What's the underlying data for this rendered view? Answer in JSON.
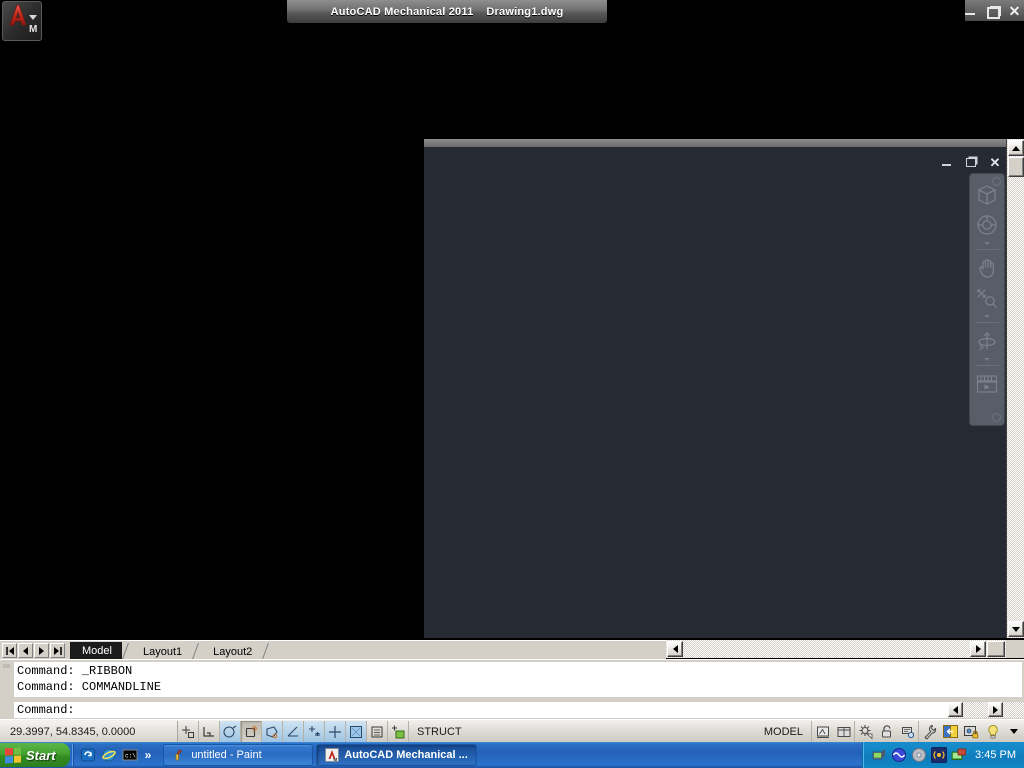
{
  "window": {
    "title": "AutoCAD Mechanical 2011    Drawing1.dwg",
    "app_button_label": "M",
    "controls": {
      "minimize": "Minimize",
      "restore": "Restore",
      "close": "Close"
    }
  },
  "drawing_window": {
    "controls": {
      "minimize": "Minimize",
      "restore": "Restore",
      "close": "Close"
    },
    "navbar": {
      "items": [
        {
          "name": "viewcube",
          "label": "ViewCube"
        },
        {
          "name": "steering-wheel",
          "label": "SteeringWheels"
        },
        {
          "name": "pan",
          "label": "Pan"
        },
        {
          "name": "zoom",
          "label": "Zoom Extents"
        },
        {
          "name": "orbit",
          "label": "Orbit"
        },
        {
          "name": "showmotion",
          "label": "ShowMotion"
        }
      ]
    }
  },
  "layout_tabs": {
    "nav_buttons": [
      "first",
      "previous",
      "next",
      "last"
    ],
    "tabs": [
      {
        "label": "Model",
        "active": true
      },
      {
        "label": "Layout1",
        "active": false
      },
      {
        "label": "Layout2",
        "active": false
      }
    ]
  },
  "command_window": {
    "history": "Command: _RIBBON\nCommand: COMMANDLINE",
    "prompt": "Command:",
    "input_value": ""
  },
  "status_bar": {
    "coordinates": "29.3997, 54.8345, 0.0000",
    "toggles": [
      {
        "name": "infer-constraints",
        "label": "Infer Constraints",
        "state": "off"
      },
      {
        "name": "snap-mode",
        "label": "Snap Mode",
        "state": "off"
      },
      {
        "name": "grid-display",
        "label": "Grid Display",
        "state": "on"
      },
      {
        "name": "ortho-mode",
        "label": "Ortho Mode",
        "state": "pressed"
      },
      {
        "name": "polar-tracking",
        "label": "Polar Tracking",
        "state": "on"
      },
      {
        "name": "object-snap",
        "label": "Object Snap",
        "state": "on"
      },
      {
        "name": "object-snap-tracking",
        "label": "Object Snap Tracking",
        "state": "on"
      },
      {
        "name": "dynamic-ucs",
        "label": "Allow/Disallow Dynamic UCS",
        "state": "on"
      },
      {
        "name": "dynamic-input",
        "label": "Dynamic Input",
        "state": "on"
      },
      {
        "name": "show-hide-lineweight",
        "label": "Show/Hide Lineweight",
        "state": "on"
      },
      {
        "name": "quick-properties",
        "label": "Quick Properties",
        "state": "on"
      }
    ],
    "struct_label": "STRUCT",
    "space_label": "MODEL",
    "right_icons": [
      {
        "name": "viewport-maximize",
        "label": "Maximize Viewport"
      },
      {
        "name": "viewport-config",
        "label": "Viewport Configuration"
      },
      {
        "name": "annotation-scale-gear",
        "label": "Annotation Scale"
      },
      {
        "name": "annotation-visibility-lock",
        "label": "Annotation Visibility"
      },
      {
        "name": "autoscale",
        "label": "Add Scales To Annotative Objects"
      },
      {
        "name": "workspace-switching",
        "label": "Workspace Switching"
      },
      {
        "name": "toolbar-window-positions",
        "label": "Toolbar/Window Positions"
      },
      {
        "name": "hardware-acceleration-lock",
        "label": "Hardware Acceleration"
      },
      {
        "name": "clean-screen",
        "label": "Clean Screen"
      },
      {
        "name": "status-menu-arrow",
        "label": "Status Bar Menu"
      }
    ]
  },
  "taskbar": {
    "start_label": "Start",
    "quick_launch": [
      {
        "name": "show-desktop-icon",
        "label": "Show Desktop"
      },
      {
        "name": "internet-explorer-icon",
        "label": "Internet Explorer"
      },
      {
        "name": "command-prompt-icon",
        "label": "Command Prompt"
      }
    ],
    "quick_launch_more": "»",
    "buttons": [
      {
        "name": "paint",
        "label": "untitled - Paint",
        "active": false
      },
      {
        "name": "autocad",
        "label": "AutoCAD Mechanical ...",
        "active": true
      }
    ],
    "tray_icons": [
      {
        "name": "network-icon",
        "label": "Network"
      },
      {
        "name": "audio-icon",
        "label": "Audio"
      },
      {
        "name": "disc-icon",
        "label": "Disc"
      },
      {
        "name": "wireless-icon",
        "label": "Wireless"
      },
      {
        "name": "display-icon",
        "label": "Display"
      }
    ],
    "clock": "3:45 PM"
  },
  "colors": {
    "canvas_dark": "#252a33",
    "desktop_black": "#000000",
    "ui_face": "#d4d0c8",
    "taskbar_blue": "#2461b8",
    "accent_red": "#c0392b"
  }
}
